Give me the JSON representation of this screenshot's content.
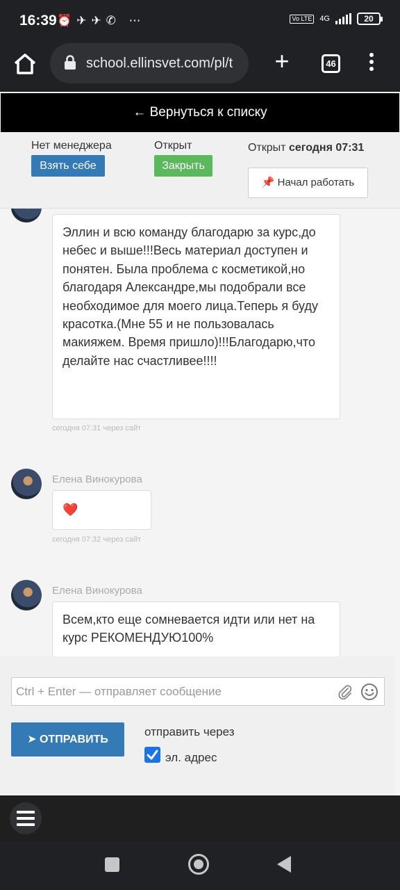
{
  "status_bar": {
    "time": "16:39",
    "network": "4G",
    "volte": "Vo LTE",
    "battery": "20"
  },
  "browser": {
    "url": "school.ellinsvet.com/pl/t",
    "tab_count": "46"
  },
  "page": {
    "back_link": "← Вернуться к списку",
    "manager_label": "Нет менеджера",
    "take_button": "Взять себе",
    "status_label": "Открыт",
    "close_button": "Закрыть",
    "opened_prefix": "Открыт",
    "opened_time": "сегодня 07:31",
    "start_work_button": "Начал работать"
  },
  "messages": [
    {
      "author": "",
      "text": "Эллин и всю команду благодарю за курс,до небес и выше!!!Весь материал доступен и понятен. Была проблема с косметикой,но благодаря Александре,мы подобрали все необходимое для моего лица.Теперь я буду красотка.(Мне 55 и не пользовалась макияжем. Время пришло)!!!Благодарю,что делайте нас счастливее!!!!",
      "meta": "сегодня 07:31 через сайт"
    },
    {
      "author": "Елена Винокурова",
      "text": "❤️",
      "meta": "сегодня 07:32 через сайт"
    },
    {
      "author": "Елена Винокурова",
      "text": "Всем,кто еще сомневается идти или нет на курс РЕКОМЕНДУЮ100%",
      "meta": ""
    }
  ],
  "composer": {
    "placeholder": "Ctrl + Enter — отправляет сообщение",
    "send_button": "ОТПРАВИТЬ",
    "via_label": "отправить через",
    "email_label": "эл. адрес",
    "email_checked": true
  },
  "colors": {
    "primary": "#337ab7",
    "success": "#5cb85c",
    "checkbox": "#1a73e8"
  }
}
